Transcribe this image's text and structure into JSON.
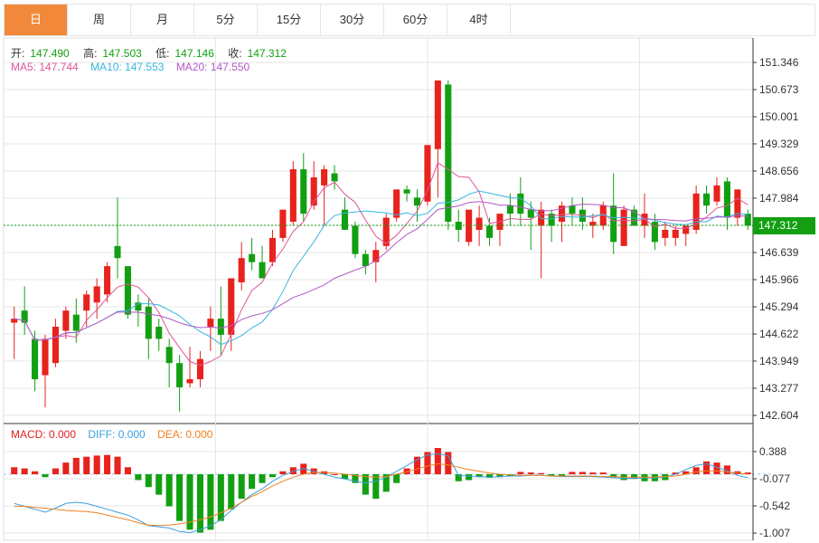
{
  "tabs": [
    {
      "label": "日",
      "active": true
    },
    {
      "label": "周",
      "active": false
    },
    {
      "label": "月",
      "active": false
    },
    {
      "label": "5分",
      "active": false
    },
    {
      "label": "15分",
      "active": false
    },
    {
      "label": "30分",
      "active": false
    },
    {
      "label": "60分",
      "active": false
    },
    {
      "label": "4时",
      "active": false
    }
  ],
  "ohlc_legend": {
    "open_label": "开:",
    "open": "147.490",
    "high_label": "高:",
    "high": "147.503",
    "low_label": "低:",
    "low": "147.146",
    "close_label": "收:",
    "close": "147.312"
  },
  "ma_legend": {
    "ma5": "MA5: 147.744",
    "ma5_color": "#e0559a",
    "ma10": "MA10: 147.553",
    "ma10_color": "#38b6e0",
    "ma20": "MA20: 147.550",
    "ma20_color": "#b259c8"
  },
  "macd_legend": {
    "macd": "MACD: 0.000",
    "macd_color": "#e02020",
    "diff": "DIFF: 0.000",
    "diff_color": "#3aa0e0",
    "dea": "DEA: 0.000",
    "dea_color": "#f08020"
  },
  "last_price": "147.312",
  "colors": {
    "up": "#e8221c",
    "down": "#12a012",
    "grid": "#e6e6e6",
    "accent": "#f2893a"
  },
  "chart_data": {
    "type": "candlestick",
    "price_axis": {
      "ticks": [
        "151.346",
        "150.673",
        "150.001",
        "149.329",
        "148.656",
        "147.984",
        "147.312",
        "146.639",
        "145.966",
        "145.294",
        "144.622",
        "143.949",
        "143.277",
        "142.604"
      ],
      "ylim": [
        142.604,
        151.346
      ]
    },
    "macd_axis": {
      "ticks": [
        "0.388",
        "-0.077",
        "-0.542",
        "-1.007"
      ],
      "ylim": [
        -1.007,
        0.388
      ]
    },
    "candles": [
      [
        144.9,
        145.3,
        144.0,
        145.0
      ],
      [
        145.2,
        145.8,
        144.6,
        144.9
      ],
      [
        144.5,
        144.7,
        143.2,
        143.5
      ],
      [
        143.6,
        144.6,
        142.8,
        144.5
      ],
      [
        143.9,
        145.0,
        143.8,
        144.8
      ],
      [
        144.7,
        145.3,
        144.5,
        145.2
      ],
      [
        145.1,
        145.5,
        144.4,
        144.7
      ],
      [
        145.2,
        145.7,
        144.8,
        145.6
      ],
      [
        145.4,
        146.0,
        145.0,
        145.8
      ],
      [
        145.6,
        146.4,
        145.4,
        146.3
      ],
      [
        146.8,
        148.0,
        146.0,
        146.5
      ],
      [
        146.3,
        146.3,
        145.0,
        145.1
      ],
      [
        145.4,
        145.6,
        144.8,
        145.2
      ],
      [
        145.3,
        145.5,
        144.0,
        144.5
      ],
      [
        144.8,
        145.0,
        144.2,
        144.5
      ],
      [
        144.3,
        144.5,
        143.3,
        143.9
      ],
      [
        143.9,
        144.1,
        142.7,
        143.3
      ],
      [
        143.4,
        144.3,
        143.3,
        143.5
      ],
      [
        143.5,
        144.2,
        143.3,
        144.0
      ],
      [
        144.8,
        145.3,
        144.2,
        145.0
      ],
      [
        145.0,
        145.8,
        144.1,
        144.6
      ],
      [
        144.6,
        146.0,
        144.2,
        146.0
      ],
      [
        145.9,
        146.9,
        145.7,
        146.5
      ],
      [
        146.6,
        147.0,
        146.2,
        146.4
      ],
      [
        146.4,
        146.8,
        146.0,
        146.0
      ],
      [
        146.4,
        147.2,
        146.3,
        147.0
      ],
      [
        147.0,
        147.6,
        146.9,
        147.7
      ],
      [
        147.4,
        148.9,
        147.3,
        148.7
      ],
      [
        148.7,
        149.1,
        147.4,
        147.6
      ],
      [
        147.8,
        148.9,
        147.7,
        148.5
      ],
      [
        148.3,
        148.8,
        147.3,
        148.7
      ],
      [
        148.6,
        148.8,
        148.2,
        148.4
      ],
      [
        147.7,
        148.0,
        147.2,
        147.2
      ],
      [
        147.3,
        147.4,
        146.5,
        146.6
      ],
      [
        146.6,
        146.7,
        146.1,
        146.3
      ],
      [
        146.4,
        146.9,
        145.9,
        146.7
      ],
      [
        146.8,
        147.6,
        146.7,
        147.5
      ],
      [
        147.5,
        148.2,
        147.4,
        148.2
      ],
      [
        148.2,
        148.3,
        147.9,
        148.1
      ],
      [
        148.0,
        148.2,
        147.4,
        147.8
      ],
      [
        147.9,
        149.3,
        147.8,
        149.3
      ],
      [
        149.2,
        149.4,
        148.0,
        150.9
      ],
      [
        150.8,
        150.9,
        147.2,
        147.4
      ],
      [
        147.4,
        147.7,
        146.9,
        147.2
      ],
      [
        146.9,
        147.6,
        146.8,
        147.7
      ],
      [
        147.2,
        147.8,
        146.8,
        147.5
      ],
      [
        147.3,
        147.5,
        146.8,
        147.0
      ],
      [
        147.2,
        147.6,
        146.8,
        147.6
      ],
      [
        147.8,
        148.1,
        147.3,
        147.6
      ],
      [
        148.1,
        148.5,
        147.3,
        147.6
      ],
      [
        147.7,
        147.9,
        146.7,
        147.5
      ],
      [
        147.3,
        147.9,
        146.0,
        147.7
      ],
      [
        147.6,
        147.7,
        146.9,
        147.3
      ],
      [
        147.4,
        147.9,
        146.9,
        147.8
      ],
      [
        147.8,
        148.0,
        147.3,
        147.6
      ],
      [
        147.7,
        148.0,
        147.2,
        147.4
      ],
      [
        147.3,
        147.6,
        147.0,
        147.4
      ],
      [
        147.3,
        147.9,
        147.2,
        147.8
      ],
      [
        147.8,
        148.6,
        146.6,
        146.9
      ],
      [
        146.8,
        147.8,
        146.8,
        147.7
      ],
      [
        147.7,
        147.8,
        147.3,
        147.3
      ],
      [
        147.3,
        148.1,
        147.0,
        147.6
      ],
      [
        147.4,
        147.6,
        146.7,
        146.9
      ],
      [
        147.0,
        147.4,
        146.8,
        147.2
      ],
      [
        147.0,
        147.3,
        146.8,
        147.2
      ],
      [
        147.1,
        147.3,
        146.8,
        147.3
      ],
      [
        147.2,
        148.3,
        147.1,
        148.1
      ],
      [
        148.1,
        148.3,
        147.6,
        147.8
      ],
      [
        147.9,
        148.5,
        147.8,
        148.3
      ],
      [
        148.4,
        148.5,
        147.2,
        147.5
      ],
      [
        147.5,
        148.2,
        147.3,
        148.2
      ],
      [
        147.6,
        147.7,
        147.2,
        147.3
      ]
    ],
    "macd_hist": [
      0.12,
      0.1,
      0.05,
      -0.05,
      0.1,
      0.2,
      0.28,
      0.3,
      0.32,
      0.33,
      0.3,
      0.12,
      -0.1,
      -0.22,
      -0.35,
      -0.55,
      -0.8,
      -0.95,
      -1.0,
      -0.95,
      -0.8,
      -0.6,
      -0.42,
      -0.25,
      -0.15,
      -0.05,
      0.05,
      0.12,
      0.18,
      0.1,
      0.05,
      0.0,
      -0.08,
      -0.15,
      -0.35,
      -0.42,
      -0.3,
      -0.15,
      0.1,
      0.3,
      0.38,
      0.45,
      0.38,
      -0.12,
      -0.1,
      -0.05,
      -0.06,
      -0.05,
      -0.04,
      0.04,
      0.03,
      0.02,
      -0.03,
      -0.04,
      0.04,
      0.04,
      0.03,
      0.03,
      -0.05,
      -0.1,
      -0.08,
      -0.12,
      -0.12,
      -0.1,
      0.03,
      0.05,
      0.12,
      0.22,
      0.2,
      0.15,
      0.05,
      0.03
    ],
    "diff": [
      -0.5,
      -0.55,
      -0.6,
      -0.65,
      -0.58,
      -0.5,
      -0.48,
      -0.5,
      -0.55,
      -0.6,
      -0.65,
      -0.7,
      -0.78,
      -0.88,
      -0.9,
      -0.92,
      -0.98,
      -1.0,
      -0.95,
      -0.88,
      -0.78,
      -0.62,
      -0.48,
      -0.35,
      -0.25,
      -0.12,
      -0.02,
      0.05,
      0.1,
      0.05,
      0.0,
      -0.05,
      -0.08,
      -0.12,
      -0.15,
      -0.12,
      -0.05,
      0.05,
      0.15,
      0.25,
      0.33,
      0.35,
      0.32,
      -0.02,
      -0.03,
      -0.04,
      -0.05,
      -0.04,
      -0.03,
      -0.03,
      -0.02,
      -0.02,
      -0.03,
      -0.04,
      -0.04,
      -0.04,
      -0.04,
      -0.05,
      -0.06,
      -0.07,
      -0.07,
      -0.06,
      -0.06,
      -0.05,
      0.0,
      0.08,
      0.15,
      0.18,
      0.12,
      0.06,
      -0.02,
      -0.06
    ],
    "dea": [
      -0.55,
      -0.55,
      -0.57,
      -0.58,
      -0.6,
      -0.62,
      -0.63,
      -0.64,
      -0.66,
      -0.7,
      -0.74,
      -0.78,
      -0.83,
      -0.87,
      -0.88,
      -0.87,
      -0.85,
      -0.82,
      -0.78,
      -0.73,
      -0.66,
      -0.58,
      -0.48,
      -0.38,
      -0.3,
      -0.2,
      -0.12,
      -0.05,
      0.0,
      0.03,
      0.03,
      0.02,
      0.0,
      -0.02,
      -0.04,
      -0.05,
      -0.04,
      0.0,
      0.04,
      0.09,
      0.14,
      0.18,
      0.16,
      0.12,
      0.08,
      0.05,
      0.02,
      0.0,
      -0.01,
      -0.02,
      -0.02,
      -0.02,
      -0.03,
      -0.03,
      -0.03,
      -0.03,
      -0.03,
      -0.04,
      -0.04,
      -0.05,
      -0.05,
      -0.05,
      -0.05,
      -0.04,
      -0.03,
      0.0,
      0.04,
      0.06,
      0.06,
      0.04,
      0.02,
      0.0
    ],
    "x_divisions": 3
  }
}
